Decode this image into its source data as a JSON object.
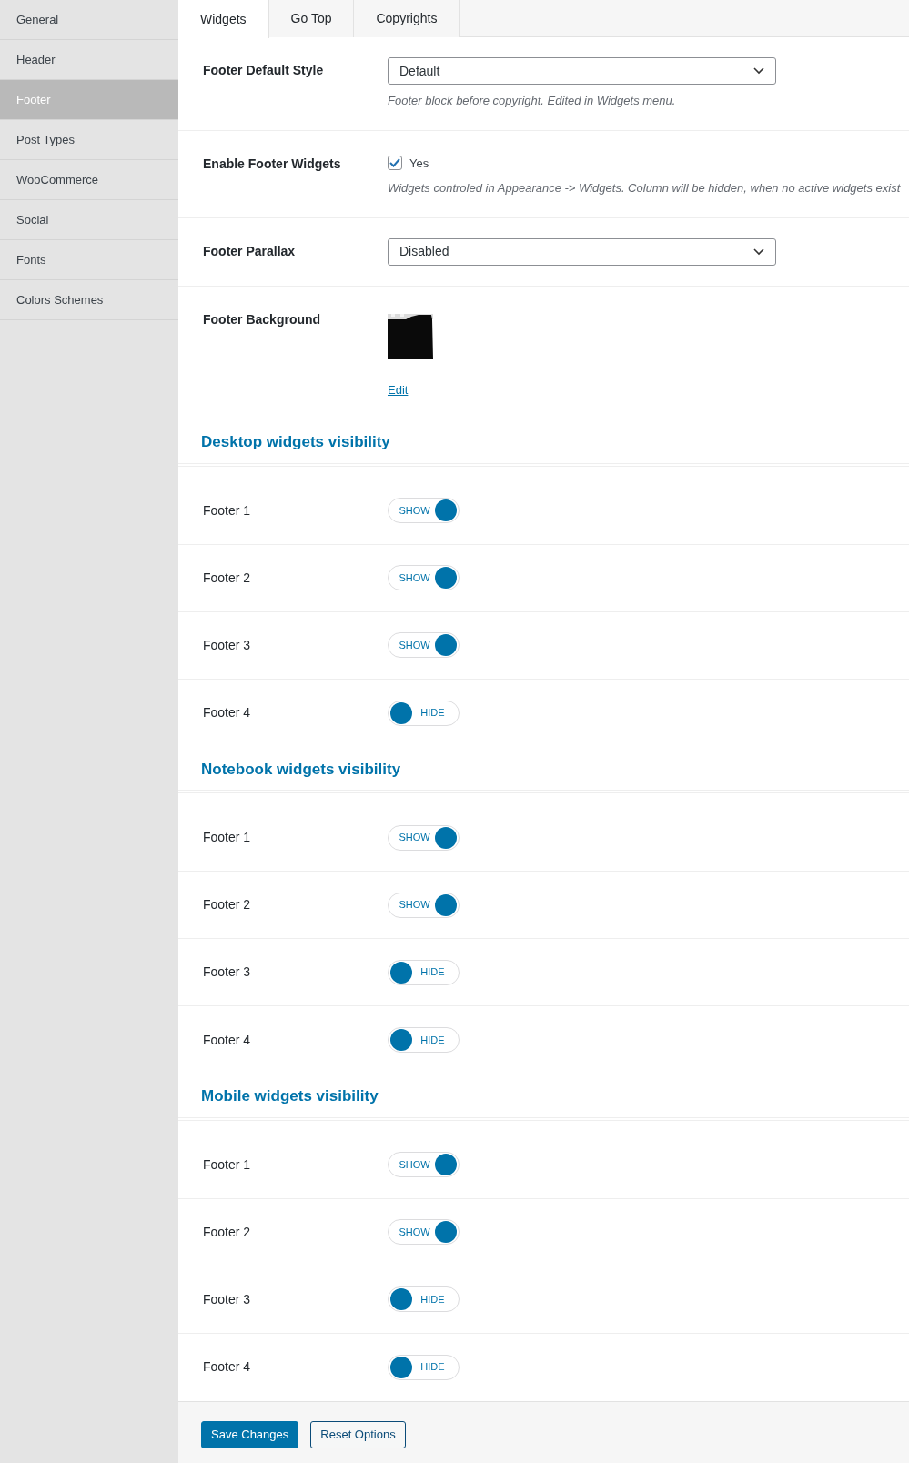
{
  "sidebar": {
    "items": [
      {
        "label": "General",
        "selected": false
      },
      {
        "label": "Header",
        "selected": false
      },
      {
        "label": "Footer",
        "selected": true
      },
      {
        "label": "Post Types",
        "selected": false
      },
      {
        "label": "WooCommerce",
        "selected": false
      },
      {
        "label": "Social",
        "selected": false
      },
      {
        "label": "Fonts",
        "selected": false
      },
      {
        "label": "Colors Schemes",
        "selected": false
      }
    ]
  },
  "tabs": [
    {
      "label": "Widgets",
      "selected": true
    },
    {
      "label": "Go Top",
      "selected": false
    },
    {
      "label": "Copyrights",
      "selected": false
    }
  ],
  "settings": [
    {
      "kind": "select",
      "label": "Footer Default Style",
      "value": "Default",
      "description": "Footer block before copyright. Edited in Widgets menu."
    },
    {
      "kind": "checkbox",
      "label": "Enable Footer Widgets",
      "option": "Yes",
      "checked": true,
      "description": "Widgets controled in Appearance -> Widgets. Column will be hidden, when no active widgets exist"
    },
    {
      "kind": "select",
      "label": "Footer Parallax",
      "value": "Disabled"
    },
    {
      "label": "Footer Background",
      "link": "Edit"
    }
  ],
  "sections": [
    {
      "title": "Desktop widgets visibility",
      "rows": [
        {
          "label": "Footer 1",
          "toggle": "SHOW",
          "on": true
        },
        {
          "label": "Footer 2",
          "toggle": "SHOW",
          "on": true
        },
        {
          "label": "Footer 3",
          "toggle": "SHOW",
          "on": true
        },
        {
          "label": "Footer 4",
          "toggle": "HIDE",
          "on": false
        }
      ]
    },
    {
      "title": "Notebook widgets visibility",
      "rows": [
        {
          "label": "Footer 1",
          "toggle": "SHOW",
          "on": true
        },
        {
          "label": "Footer 2",
          "toggle": "SHOW",
          "on": true
        },
        {
          "label": "Footer 3",
          "toggle": "HIDE",
          "on": false
        },
        {
          "label": "Footer 4",
          "toggle": "HIDE",
          "on": false
        }
      ]
    },
    {
      "title": "Mobile widgets visibility",
      "rows": [
        {
          "label": "Footer 1",
          "toggle": "SHOW",
          "on": true
        },
        {
          "label": "Footer 2",
          "toggle": "SHOW",
          "on": true
        },
        {
          "label": "Footer 3",
          "toggle": "HIDE",
          "on": false
        },
        {
          "label": "Footer 4",
          "toggle": "HIDE",
          "on": false
        }
      ]
    }
  ],
  "buttons": [
    {
      "label": "Save Changes",
      "kind": "primary"
    },
    {
      "label": "Reset Options",
      "kind": "secondary"
    }
  ]
}
